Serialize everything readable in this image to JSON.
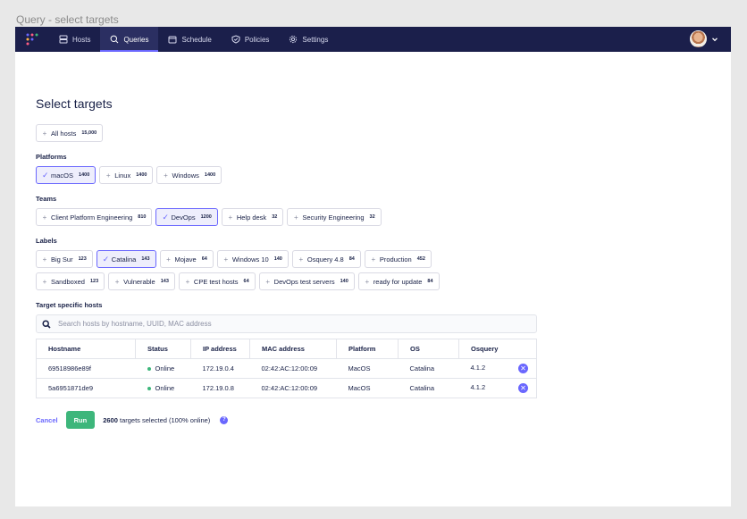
{
  "frame_title": "Query - select targets",
  "nav": {
    "items": [
      {
        "label": "Hosts",
        "icon": "hosts-icon"
      },
      {
        "label": "Queries",
        "icon": "queries-icon",
        "active": true
      },
      {
        "label": "Schedule",
        "icon": "schedule-icon"
      },
      {
        "label": "Policies",
        "icon": "policies-icon"
      },
      {
        "label": "Settings",
        "icon": "settings-icon"
      }
    ]
  },
  "page_title": "Select targets",
  "all_hosts": {
    "label": "All hosts",
    "count": "15,000"
  },
  "platforms": {
    "title": "Platforms",
    "items": [
      {
        "label": "macOS",
        "count": "1400",
        "selected": true
      },
      {
        "label": "Linux",
        "count": "1400"
      },
      {
        "label": "Windows",
        "count": "1400"
      }
    ]
  },
  "teams": {
    "title": "Teams",
    "items": [
      {
        "label": "Client Platform Engineering",
        "count": "810"
      },
      {
        "label": "DevOps",
        "count": "1200",
        "selected": true
      },
      {
        "label": "Help desk",
        "count": "32"
      },
      {
        "label": "Security Engineering",
        "count": "32"
      }
    ]
  },
  "labels": {
    "title": "Labels",
    "items": [
      {
        "label": "Big Sur",
        "count": "123"
      },
      {
        "label": "Catalina",
        "count": "143",
        "selected": true
      },
      {
        "label": "Mojave",
        "count": "64"
      },
      {
        "label": "Windows 10",
        "count": "140"
      },
      {
        "label": "Osquery 4.8",
        "count": "84"
      },
      {
        "label": "Production",
        "count": "452"
      },
      {
        "label": "Sandboxed",
        "count": "123"
      },
      {
        "label": "Vulnerable",
        "count": "143"
      },
      {
        "label": "CPE test hosts",
        "count": "64"
      },
      {
        "label": "DevOps test servers",
        "count": "140"
      },
      {
        "label": "ready for update",
        "count": "84"
      }
    ]
  },
  "target_hosts": {
    "title": "Target specific hosts",
    "placeholder": "Search hosts by hostname, UUID, MAC address"
  },
  "table": {
    "columns": [
      "Hostname",
      "Status",
      "IP address",
      "MAC address",
      "Platform",
      "OS",
      "Osquery"
    ],
    "rows": [
      {
        "hostname": "69518986e89f",
        "status": "Online",
        "ip": "172.19.0.4",
        "mac": "02:42:AC:12:00:09",
        "platform": "MacOS",
        "os": "Catalina",
        "osquery": "4.1.2"
      },
      {
        "hostname": "5a6951871de9",
        "status": "Online",
        "ip": "172.19.0.8",
        "mac": "02:42:AC:12:00:09",
        "platform": "MacOS",
        "os": "Catalina",
        "osquery": "4.1.2"
      }
    ]
  },
  "footer": {
    "cancel": "Cancel",
    "run": "Run",
    "selected_count": "2600",
    "selected_text": "targets selected (100% online)",
    "help": "?"
  },
  "colors": {
    "nav_bg": "#1b1f4b",
    "accent": "#6a67fe",
    "success": "#3db67b"
  }
}
